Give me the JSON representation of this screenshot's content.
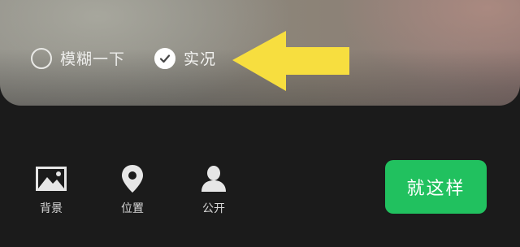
{
  "preview": {
    "options": [
      {
        "label": "模糊一下",
        "checked": false
      },
      {
        "label": "实况",
        "checked": true
      }
    ],
    "arrow_color": "#f7de3f"
  },
  "toolbar": {
    "items": [
      {
        "label": "背景",
        "icon": "image-icon"
      },
      {
        "label": "位置",
        "icon": "location-pin-icon"
      },
      {
        "label": "公开",
        "icon": "person-icon"
      }
    ]
  },
  "confirm_button": {
    "label": "就这样",
    "color": "#21c15f"
  }
}
